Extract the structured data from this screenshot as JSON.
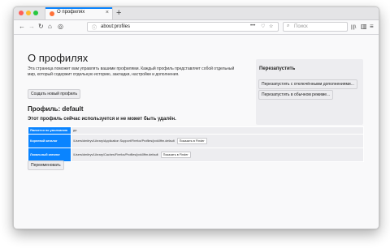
{
  "browser": {
    "tab": {
      "title": "О профилях",
      "close": "×"
    },
    "new_tab": "+",
    "nav": {
      "back": "←",
      "forward": "→",
      "reload": "↻",
      "home": "⌂",
      "extension": "◎"
    },
    "url": {
      "text": "about:profiles",
      "info": "ⓘ",
      "more": "•••",
      "pocket": "♡",
      "bookmark": "☆"
    },
    "search": {
      "placeholder": "Поиск",
      "icon": "⌕"
    },
    "toolbar_right": {
      "library": "|||\\",
      "sidebar": "▥",
      "menu": "≡"
    }
  },
  "page": {
    "title": "О профилях",
    "description": "Эта страница поможет вам управлять вашими профилями. Каждый профиль представляет собой отдельный мир, который содержит отдельную историю, закладки, настройки и дополнения.",
    "create_button": "Создать новый профиль",
    "restart": {
      "title": "Перезапустить",
      "disabled_addons_button": "Перезапустить с отключёнными дополнениями...",
      "normal_button": "Перезапустить в обычном режиме..."
    },
    "profile": {
      "heading": "Профиль: default",
      "in_use_text": "Этот профиль сейчас используется и не может быть удалён.",
      "rows": [
        {
          "label": "Является по умолчанию",
          "value": "да",
          "button": ""
        },
        {
          "label": "Корневой каталог",
          "value": "/Users/dmitryv/Library/Application Support/Firefox/Profiles/jxxk0ffm.default",
          "button": "Показать в Finder"
        },
        {
          "label": "Локальный каталог",
          "value": "/Users/dmitryv/Library/Caches/Firefox/Profiles/jxxk0ffm.default",
          "button": "Показать в Finder"
        }
      ],
      "rename_button": "Переименовать"
    }
  },
  "colors": {
    "accent": "#0a84ff",
    "panel": "#ededf0",
    "background": "#f9f9fa"
  }
}
